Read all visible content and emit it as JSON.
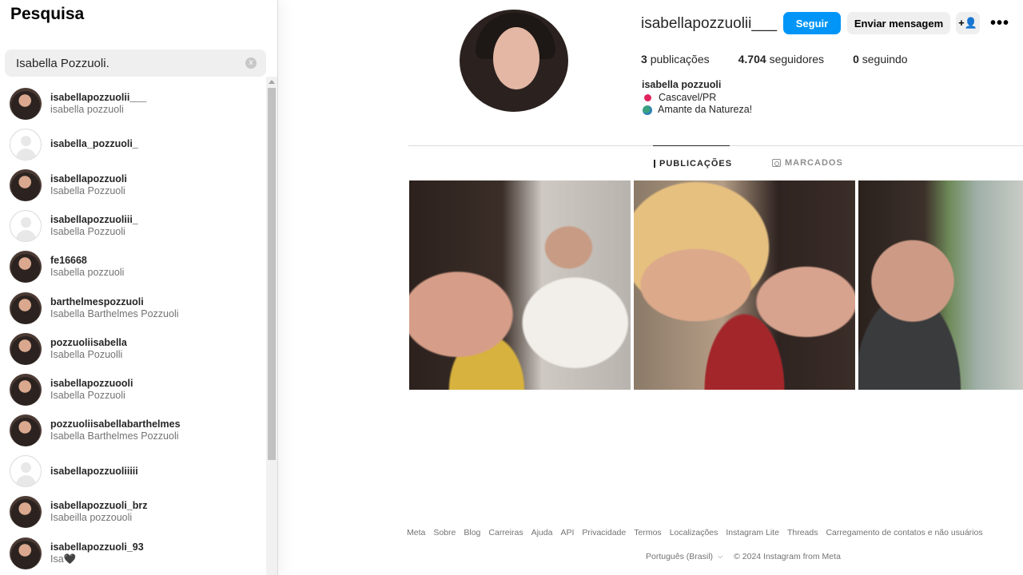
{
  "search": {
    "title": "Pesquisa",
    "value": "Isabella Pozzuoli.",
    "clear_icon": "x"
  },
  "results": [
    {
      "username": "isabellapozzuolii___",
      "name": "isabella pozzuoli",
      "avatar": "photo"
    },
    {
      "username": "isabella_pozzuoli_",
      "name": "",
      "avatar": "placeholder"
    },
    {
      "username": "isabellapozzuoli",
      "name": "Isabella Pozzuoli",
      "avatar": "photo"
    },
    {
      "username": "isabellapozzuoliii_",
      "name": "Isabella Pozzuoli",
      "avatar": "placeholder"
    },
    {
      "username": "fe16668",
      "name": "Isabella pozzuoli",
      "avatar": "photo"
    },
    {
      "username": "barthelmespozzuoli",
      "name": "Isabella Barthelmes Pozzuoli",
      "avatar": "photo"
    },
    {
      "username": "pozzuoliisabella",
      "name": "Isabella Pozuolli",
      "avatar": "photo"
    },
    {
      "username": "isabellapozzuooli",
      "name": "Isabella Pozzuoli",
      "avatar": "photo"
    },
    {
      "username": "pozzuoliisabellabarthelmes",
      "name": "Isabella Barthelmes Pozzuoli",
      "avatar": "photo"
    },
    {
      "username": "isabellapozzuoliiiii",
      "name": "",
      "avatar": "placeholder"
    },
    {
      "username": "isabellapozzuoli_brz",
      "name": "Isabeilla pozzouoli",
      "avatar": "photo"
    },
    {
      "username": "isabellapozzuoli_93",
      "name": "Isa🖤",
      "avatar": "photo"
    }
  ],
  "profile": {
    "username": "isabellapozzuolii___",
    "follow_label": "Seguir",
    "message_label": "Enviar mensagem",
    "add_user_label": "+👤",
    "more_label": "•••",
    "posts_count": "3",
    "posts_label": "publicações",
    "followers_count": "4.704",
    "followers_label": "seguidores",
    "following_count": "0",
    "following_label": "seguindo",
    "bio_name": "isabella pozzuoli",
    "bio_location": "Cascavel/PR",
    "bio_tagline": "Amante da Natureza!"
  },
  "tabs": {
    "posts": "PUBLICAÇÕES",
    "tagged": "MARCADOS"
  },
  "footer": {
    "links": [
      "Meta",
      "Sobre",
      "Blog",
      "Carreiras",
      "Ajuda",
      "API",
      "Privacidade",
      "Termos",
      "Localizações",
      "Instagram Lite",
      "Threads",
      "Carregamento de contatos e não usuários"
    ],
    "language": "Português (Brasil)",
    "copyright": "© 2024 Instagram from Meta"
  },
  "colors": {
    "accent": "#0095f6",
    "secondary_button": "#efefef",
    "muted_text": "#737373"
  }
}
